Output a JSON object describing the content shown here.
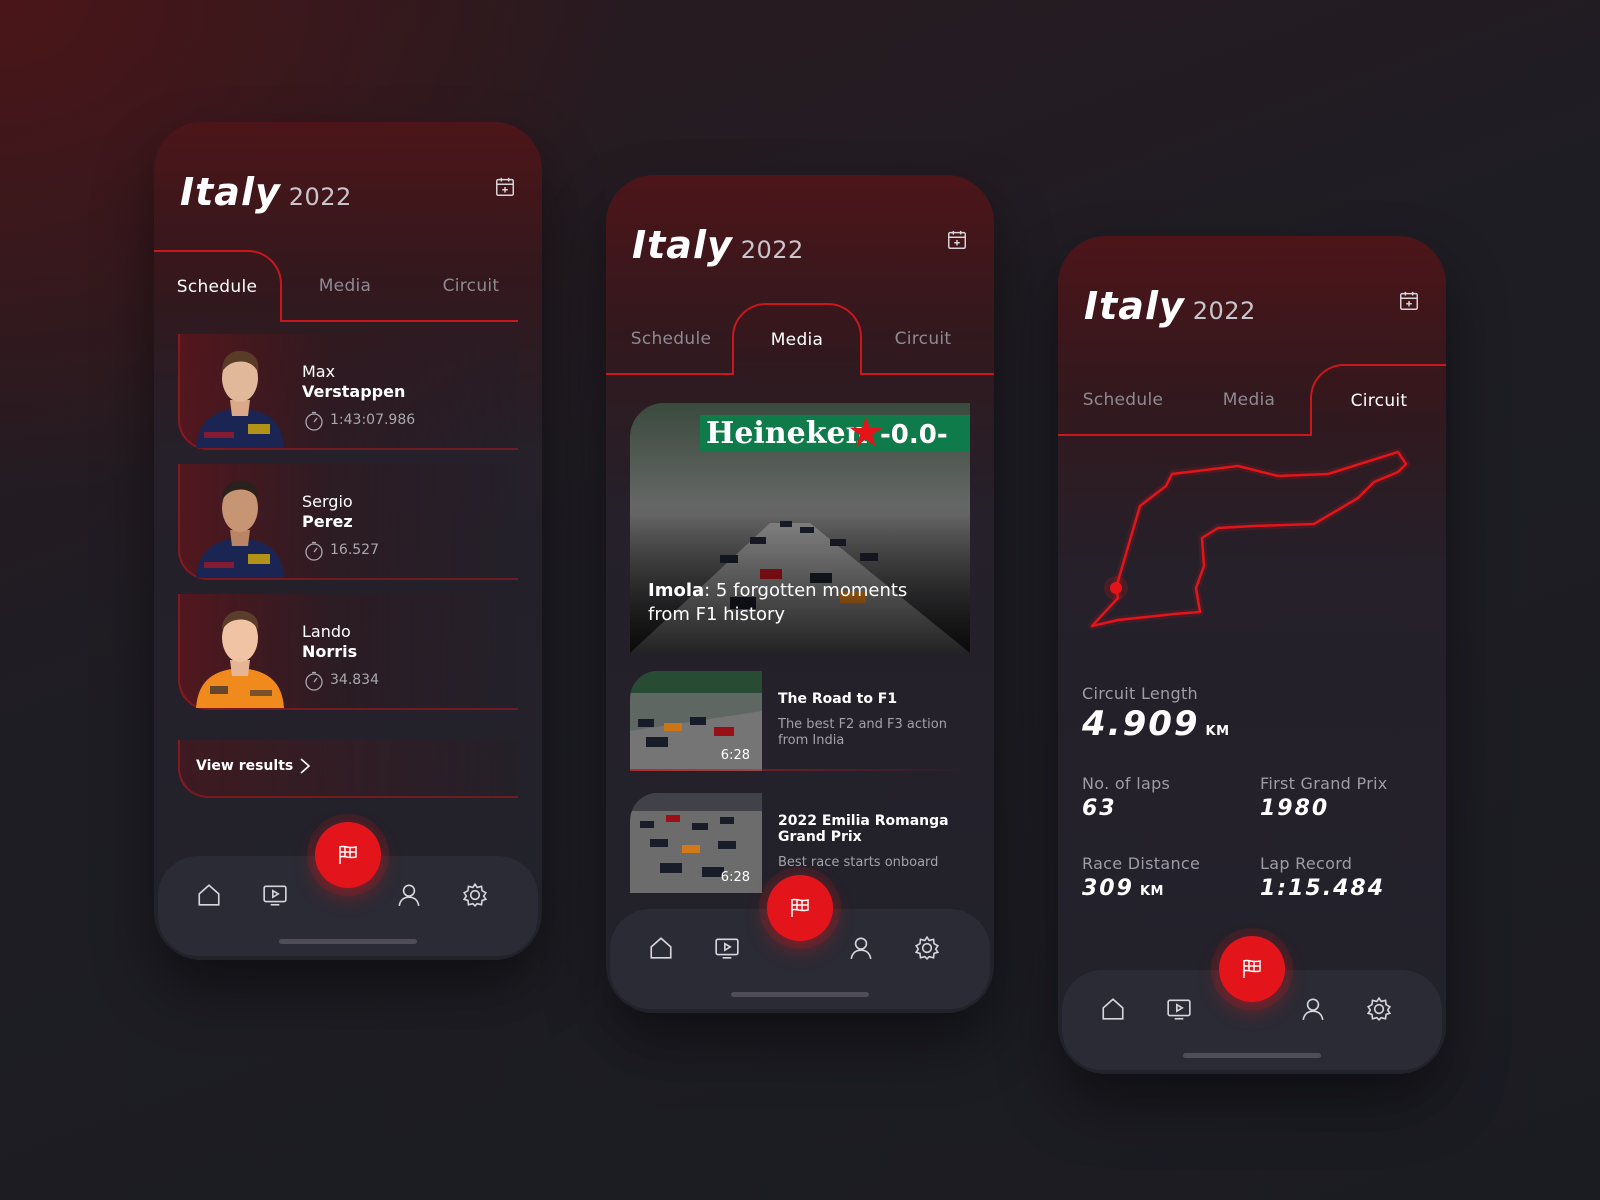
{
  "screens": [
    {
      "header": {
        "title": "Italy",
        "year": "2022"
      },
      "tabs": [
        "Schedule",
        "Media",
        "Circuit"
      ],
      "drivers": [
        {
          "first": "Max",
          "last": "Verstappen",
          "time": "1:43:07.986",
          "suit_color": "#1b2553"
        },
        {
          "first": "Sergio",
          "last": "Perez",
          "time": "16.527",
          "suit_color": "#1b2553"
        },
        {
          "first": "Lando",
          "last": "Norris",
          "time": "34.834",
          "suit_color": "#f08a1c"
        }
      ],
      "view_results": "View results"
    },
    {
      "header": {
        "title": "Italy",
        "year": "2022"
      },
      "tabs": [
        "Schedule",
        "Media",
        "Circuit"
      ],
      "hero": {
        "title_bold": "Imola",
        "title_rest": ": 5 forgotten moments from F1 history",
        "banner": "Heineken",
        "banner_tag": "-0.0-"
      },
      "items": [
        {
          "title": "The Road to F1",
          "subtitle": "The best F2 and F3 action from India",
          "duration": "6:28"
        },
        {
          "title": "2022 Emilia Romanga Grand Prix",
          "subtitle": "Best race starts onboard",
          "duration": "6:28"
        }
      ]
    },
    {
      "header": {
        "title": "Italy",
        "year": "2022"
      },
      "tabs": [
        "Schedule",
        "Media",
        "Circuit"
      ],
      "circuit_length": {
        "label": "Circuit Length",
        "value": "4.909",
        "unit": "KM"
      },
      "laps": {
        "label": "No. of laps",
        "value": "63"
      },
      "first_gp": {
        "label": "First Grand Prix",
        "value": "1980"
      },
      "race_distance": {
        "label": "Race Distance",
        "value": "309",
        "unit": "KM"
      },
      "lap_record": {
        "label": "Lap Record",
        "value": "1:15.484"
      }
    }
  ],
  "icons": {
    "nav": [
      "home-icon",
      "tv-icon",
      "flag-icon",
      "user-icon",
      "gear-icon"
    ],
    "calendar": "calendar-icon"
  },
  "colors": {
    "accent": "#e3151b",
    "accent_dark": "#c9171d",
    "nav_bg": "#2b2b35"
  }
}
